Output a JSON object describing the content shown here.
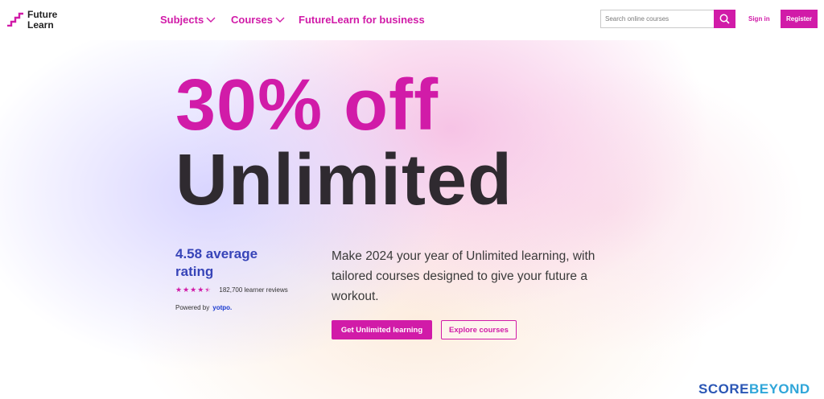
{
  "header": {
    "logo_text": "Future\nLearn",
    "nav": {
      "subjects": "Subjects",
      "courses": "Courses",
      "business": "FutureLearn for business"
    },
    "search": {
      "placeholder": "Search online courses"
    },
    "signin": "Sign in",
    "register": "Register"
  },
  "hero": {
    "headline_line1": "30% off",
    "headline_line2": "Unlimited",
    "rating": {
      "title": "4.58 average rating",
      "stars": 4.5,
      "reviews": "182,700 learner reviews",
      "powered_by": "Powered by",
      "provider": "yotpo."
    },
    "description": "Make 2024 your year of Unlimited learning, with tailored courses designed to give your future a workout.",
    "primary_cta": "Get Unlimited learning",
    "secondary_cta": "Explore courses"
  },
  "watermark": {
    "part1": "SCORE",
    "part2": "BEYOND"
  },
  "colors": {
    "brand_pink": "#d11ba8",
    "rating_blue": "#3744b8",
    "headline_dark": "#2f2a30"
  }
}
